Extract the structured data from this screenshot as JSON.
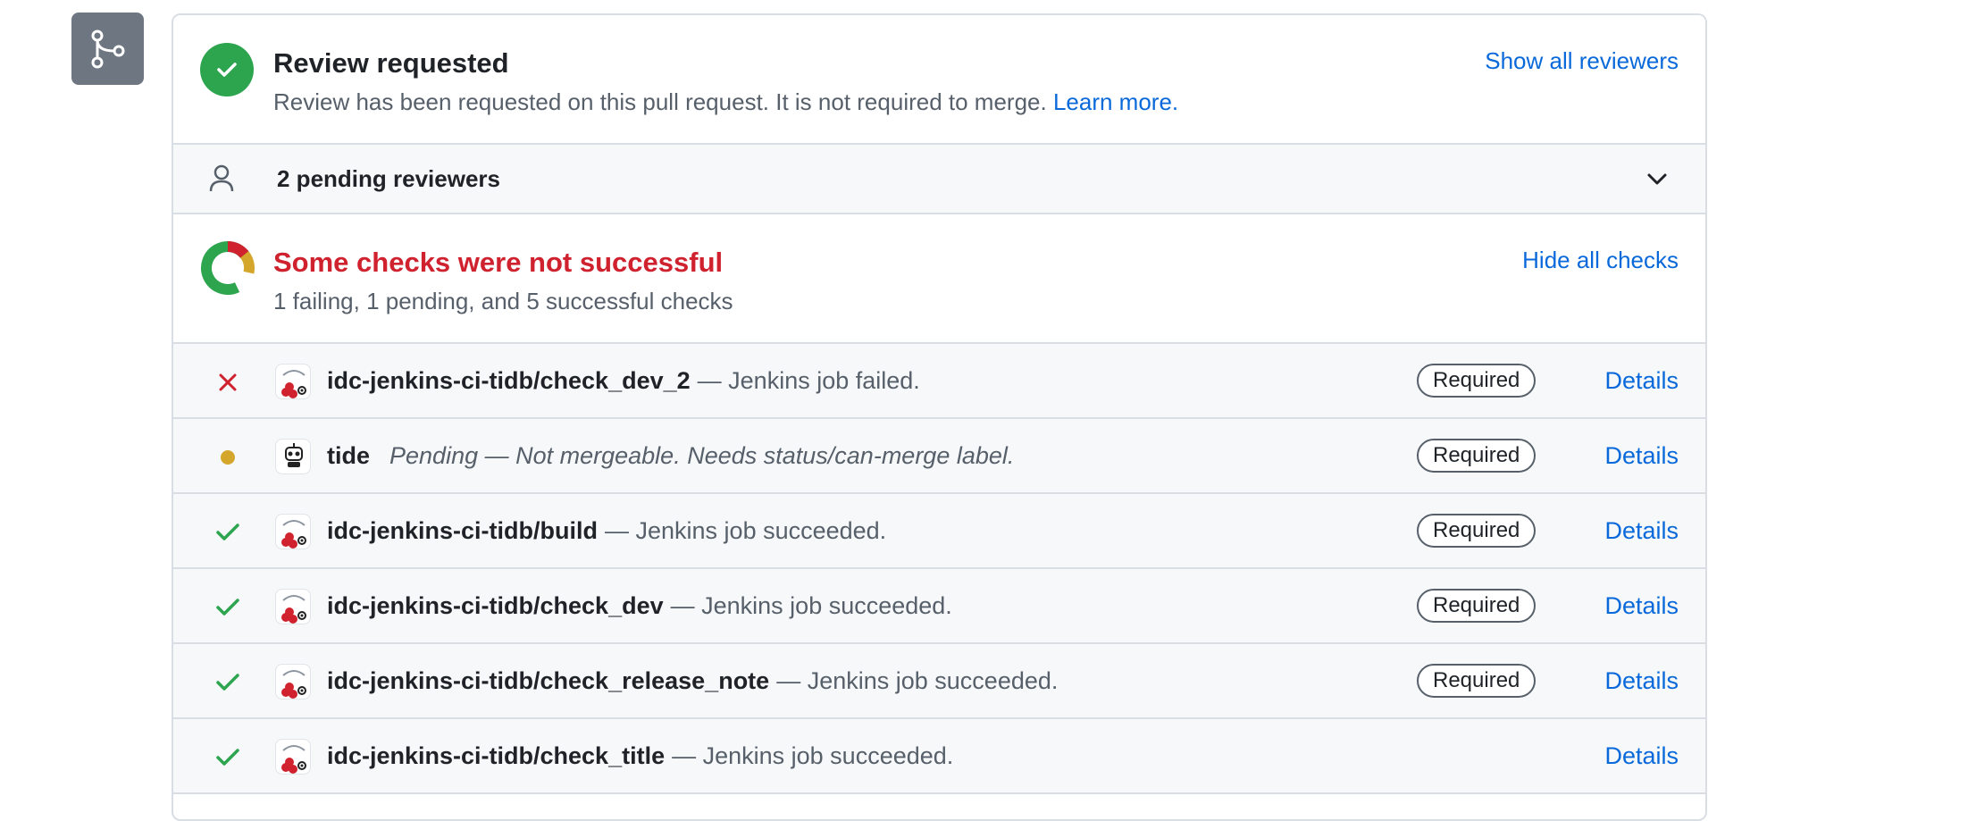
{
  "review": {
    "title": "Review requested",
    "description": "Review has been requested on this pull request. It is not required to merge.",
    "learn_more": "Learn more.",
    "show_all": "Show all reviewers"
  },
  "pending": {
    "label": "2 pending reviewers"
  },
  "checks": {
    "title": "Some checks were not successful",
    "summary": "1 failing, 1 pending, and 5 successful checks",
    "hide_all": "Hide all checks",
    "colors": {
      "failing": "#cf222e",
      "pending": "#d4a72c",
      "success": "#2da44e"
    },
    "items": [
      {
        "status": "failed",
        "status_icon": "x-icon",
        "name": "idc-jenkins-ci-tidb/check_dev_2",
        "description": "— Jenkins job failed.",
        "badge": "Required",
        "details": "Details"
      },
      {
        "status": "pending",
        "status_icon": "dot-icon",
        "name": "tide",
        "description": "Pending — Not mergeable. Needs status/can-merge label.",
        "badge": "Required",
        "details": "Details"
      },
      {
        "status": "success",
        "status_icon": "check-icon",
        "name": "idc-jenkins-ci-tidb/build",
        "description": "— Jenkins job succeeded.",
        "badge": "Required",
        "details": "Details"
      },
      {
        "status": "success",
        "status_icon": "check-icon",
        "name": "idc-jenkins-ci-tidb/check_dev",
        "description": "— Jenkins job succeeded.",
        "badge": "Required",
        "details": "Details"
      },
      {
        "status": "success",
        "status_icon": "check-icon",
        "name": "idc-jenkins-ci-tidb/check_release_note",
        "description": "— Jenkins job succeeded.",
        "badge": "Required",
        "details": "Details"
      },
      {
        "status": "success",
        "status_icon": "check-icon",
        "name": "idc-jenkins-ci-tidb/check_title",
        "description": "— Jenkins job succeeded.",
        "badge": "",
        "details": "Details"
      }
    ]
  }
}
